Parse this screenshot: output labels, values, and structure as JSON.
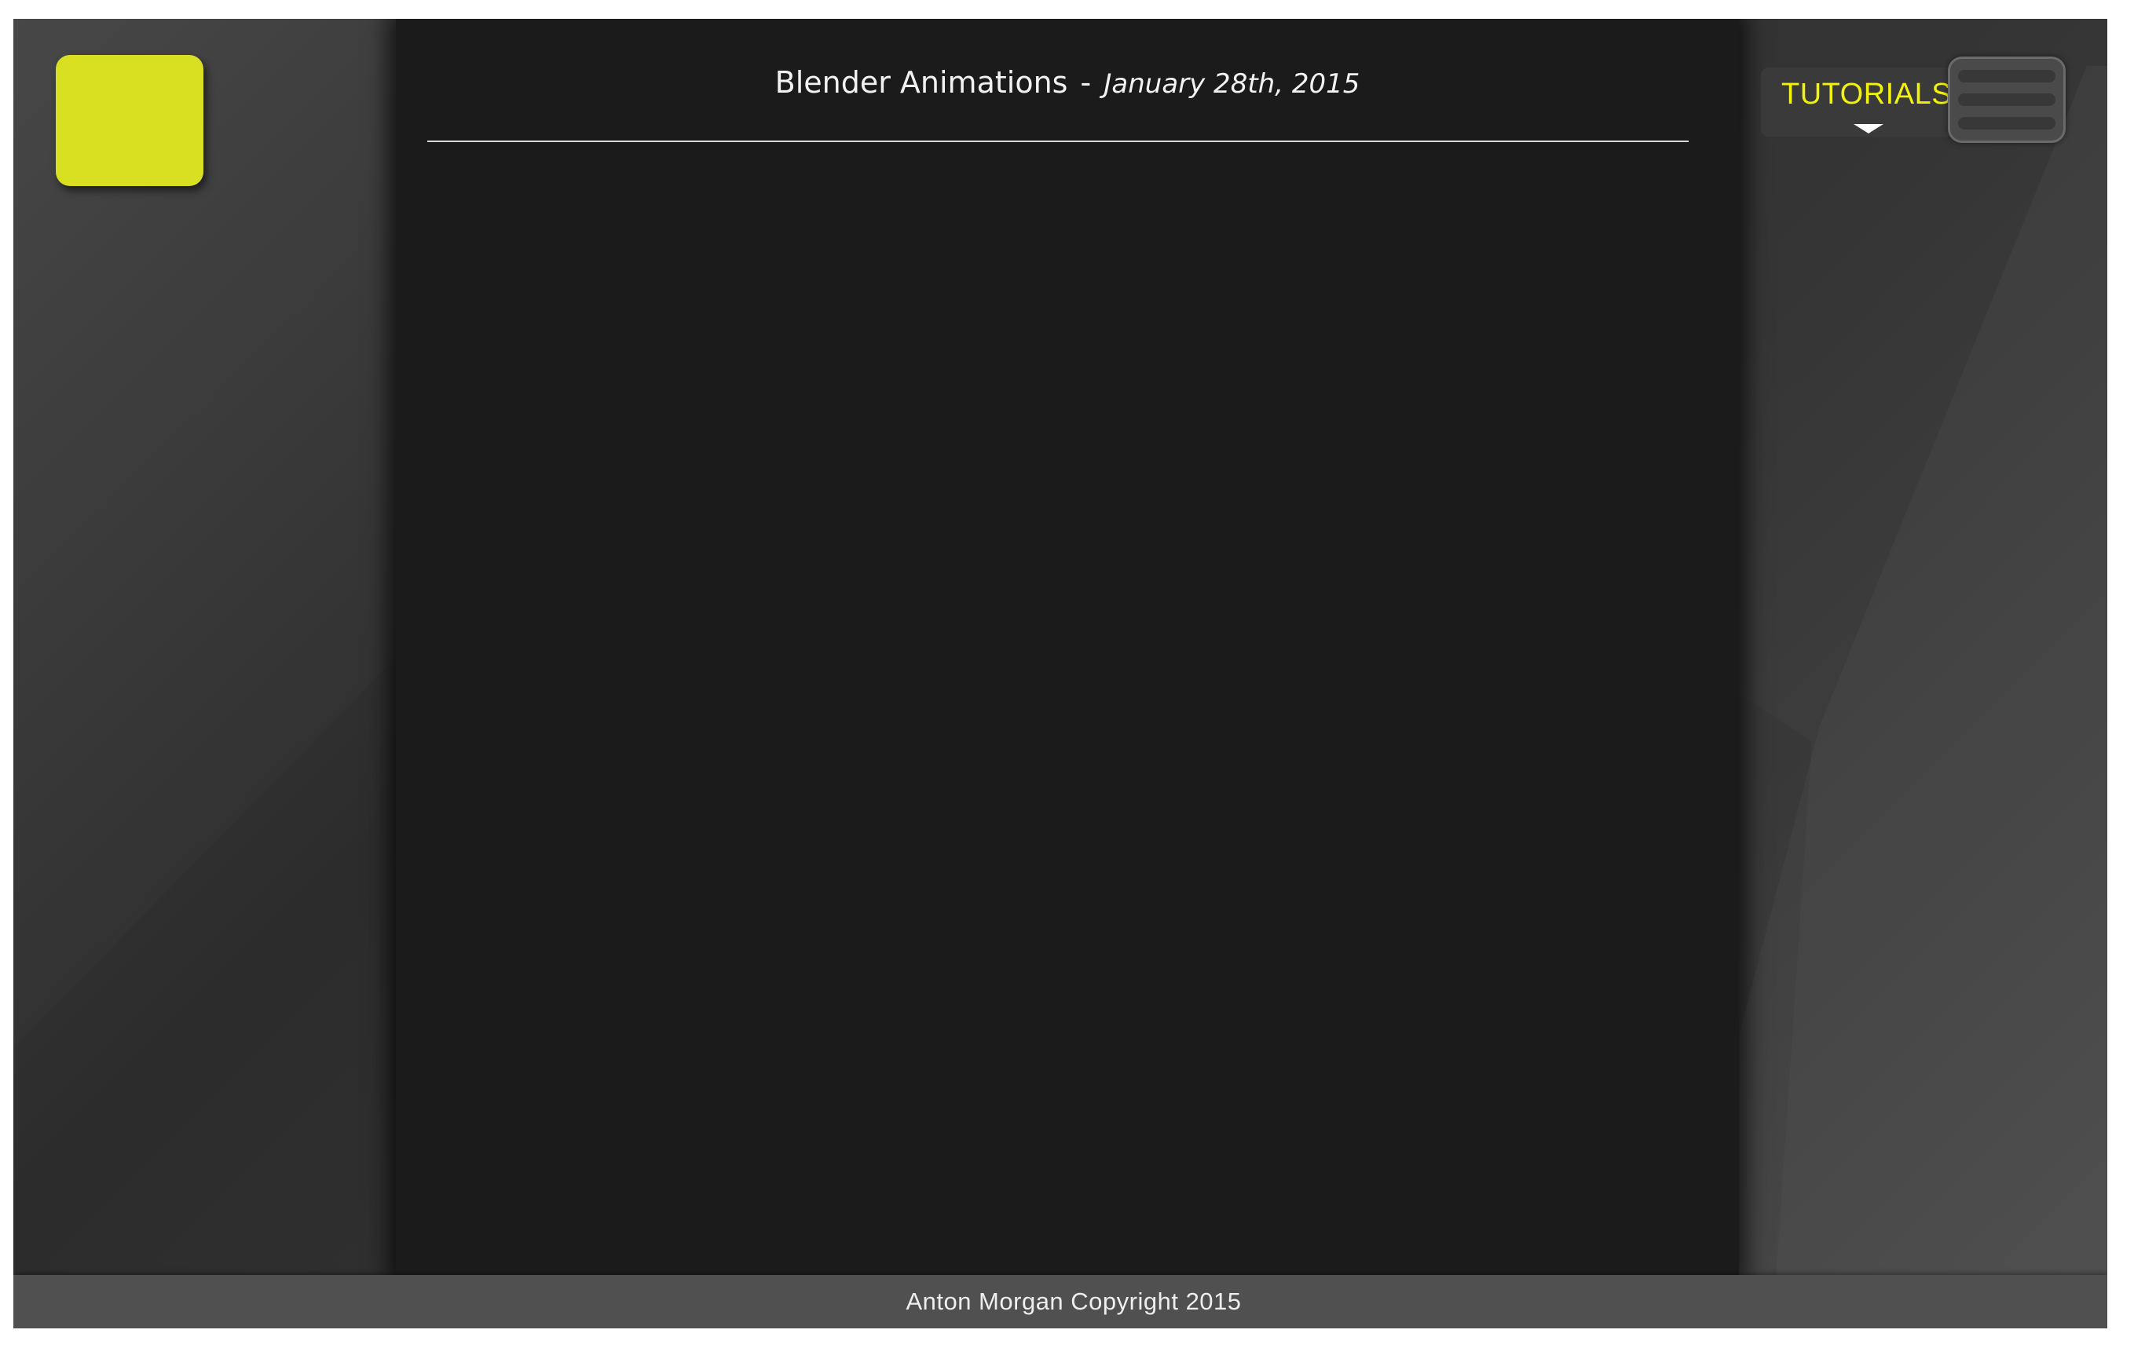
{
  "header": {
    "title": "Blender Animations",
    "separator": "-",
    "date": "January 28th, 2015"
  },
  "nav": {
    "tab_label": "TUTORIALS",
    "menu_icon": "hamburger-menu-icon",
    "caret_icon": "caret-down-icon"
  },
  "footer": {
    "text": "Anton Morgan Copyright 2015"
  },
  "colors": {
    "accent_yellow": "#d8e021",
    "nav_label": "#f2f20a",
    "content_background": "#1b1b1b",
    "footer_background": "#505050"
  }
}
